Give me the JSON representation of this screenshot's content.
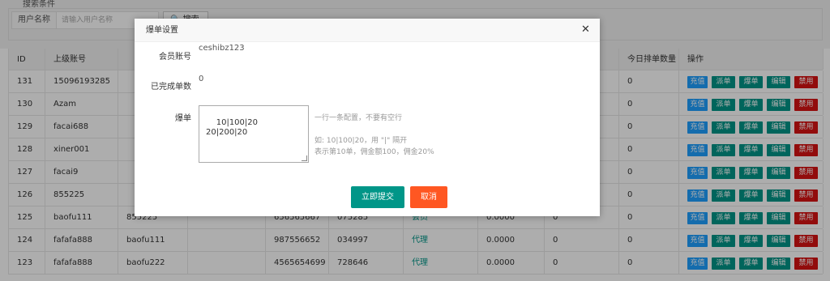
{
  "filter": {
    "section_label": "搜索条件",
    "username_label": "用户名称",
    "username_placeholder": "请输入用户名称",
    "search_label": "🔍 搜索"
  },
  "table": {
    "headers": [
      "ID",
      "上级账号",
      "",
      "",
      "",
      "",
      "",
      "",
      "",
      "今日排单数量",
      "操作"
    ],
    "rows": [
      {
        "id": "131",
        "sup": "15096193285",
        "c3": "",
        "c4": "",
        "c5": "",
        "c6": "",
        "role": "",
        "c8": "",
        "c9": "",
        "today": "0"
      },
      {
        "id": "130",
        "sup": "Azam",
        "c3": "",
        "c4": "",
        "c5": "",
        "c6": "",
        "role": "",
        "c8": "",
        "c9": "",
        "today": "0"
      },
      {
        "id": "129",
        "sup": "facai688",
        "c3": "",
        "c4": "",
        "c5": "",
        "c6": "",
        "role": "",
        "c8": "",
        "c9": "",
        "today": "0"
      },
      {
        "id": "128",
        "sup": "xiner001",
        "c3": "",
        "c4": "",
        "c5": "",
        "c6": "",
        "role": "",
        "c8": "",
        "c9": "",
        "today": "0"
      },
      {
        "id": "127",
        "sup": "facai9",
        "c3": "",
        "c4": "",
        "c5": "",
        "c6": "",
        "role": "",
        "c8": "",
        "c9": "",
        "today": "0"
      },
      {
        "id": "126",
        "sup": "855225",
        "c3": "",
        "c4": "",
        "c5": "",
        "c6": "",
        "role": "",
        "c8": "",
        "c9": "",
        "today": "0"
      },
      {
        "id": "125",
        "sup": "baofu111",
        "c3": "855225",
        "c4": "",
        "c5": "656565667",
        "c6": "075285",
        "role": "会员",
        "c8": "0.0000",
        "c9": "0",
        "today": "0"
      },
      {
        "id": "124",
        "sup": "fafafa888",
        "c3": "baofu111",
        "c4": "",
        "c5": "987556652",
        "c6": "034997",
        "role": "代理",
        "c8": "0.0000",
        "c9": "0",
        "today": "0"
      },
      {
        "id": "123",
        "sup": "fafafa888",
        "c3": "baofu222",
        "c4": "",
        "c5": "4565654699",
        "c6": "728646",
        "role": "代理",
        "c8": "0.0000",
        "c9": "0",
        "today": "0"
      }
    ],
    "ops": {
      "recharge": "充值",
      "dispatch": "派单",
      "burst": "爆单",
      "edit": "编辑",
      "disable": "禁用"
    },
    "colors": {
      "recharge": "#1e9fff",
      "green": "#009688",
      "disable": "#d71212"
    }
  },
  "modal": {
    "title": "爆单设置",
    "close_icon": "close-icon",
    "account_label": "会员账号",
    "account_value": "ceshibz123",
    "completed_label": "已完成单数",
    "completed_value": "0",
    "burst_label": "爆单",
    "burst_value": "10|100|20\n20|200|20",
    "hint_line1": "一行一条配置，不要有空行",
    "hint_line2": "如: 10|100|20，用 \"|\" 隔开",
    "hint_line3": "表示第10单，佣金额100，佣金20%",
    "submit_label": "立即提交",
    "cancel_label": "取消",
    "submit_color": "#009688",
    "cancel_color": "#ff5722"
  }
}
